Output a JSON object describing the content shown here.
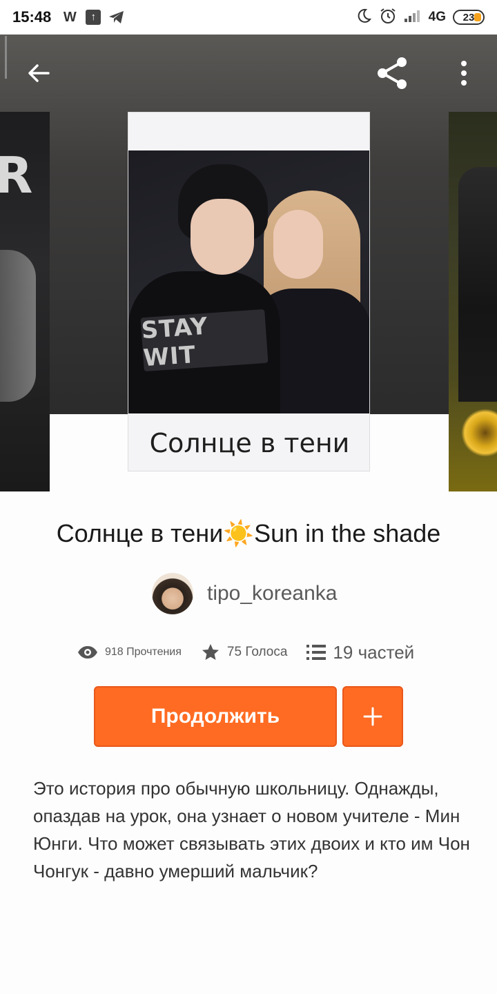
{
  "status_bar": {
    "time": "15:48",
    "network": "4G",
    "battery": "23",
    "icons": [
      "wattpad-icon",
      "upload-icon",
      "telegram-icon",
      "moon-icon",
      "alarm-icon",
      "signal-icon"
    ]
  },
  "toolbar": {
    "icons": [
      "back-arrow-icon",
      "share-icon",
      "more-vertical-icon"
    ]
  },
  "cover": {
    "sign_text": "STAY WIT",
    "caption": "Солнце в тени",
    "left_cover_letter": "R"
  },
  "story": {
    "title": "Солнце в тени☀️Sun in the shade",
    "author": "tipo_koreanka",
    "reads": "918 Прочтения",
    "votes": "75 Голоса",
    "parts": "19 частей",
    "description": "Это история про обычную школьницу. Однажды, опаздав на урок, она узнает о новом учителе - Мин Юнги. Что может связывать этих двоих и кто им Чон Чонгук - давно умерший мальчик?"
  },
  "actions": {
    "continue_label": "Продолжить",
    "add_label": "+"
  },
  "colors": {
    "accent": "#ff6b22",
    "accent_border": "#e9581a",
    "text_primary": "#1a1a1a",
    "text_secondary": "#5a5a5a"
  }
}
